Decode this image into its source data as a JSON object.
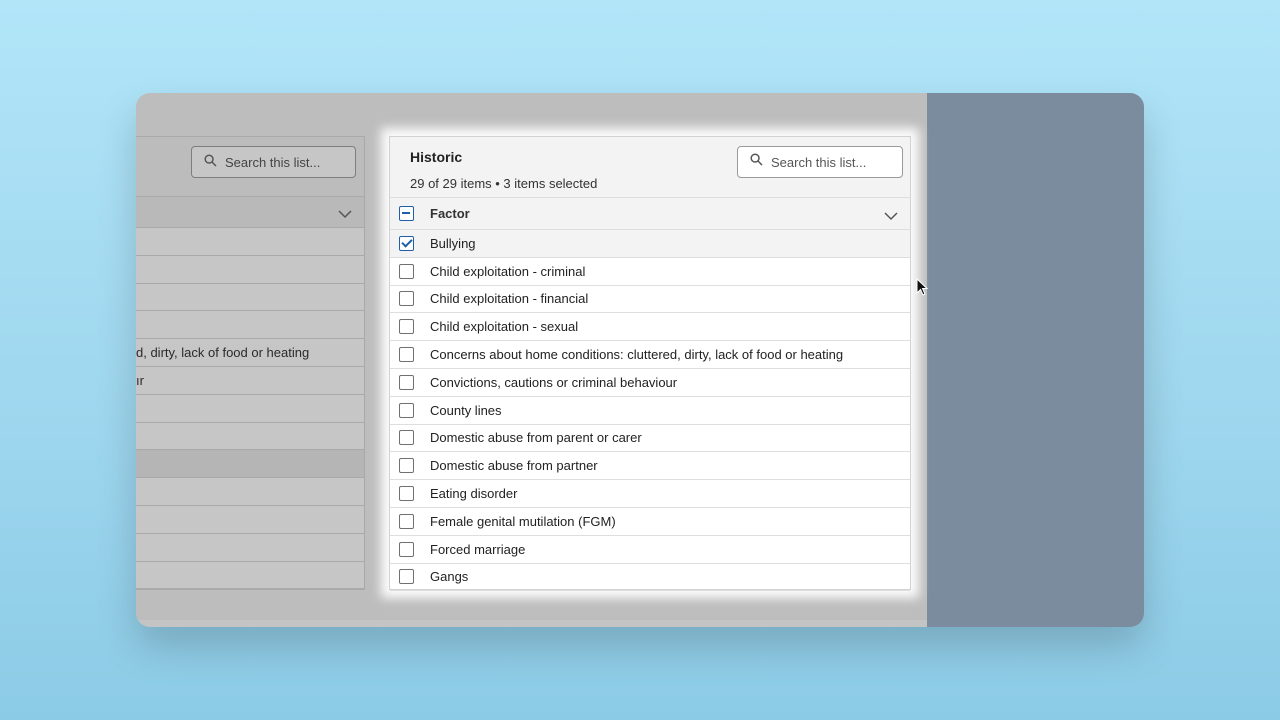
{
  "background_panel": {
    "search_placeholder": "Search this list...",
    "rows": [
      "",
      "",
      "",
      "",
      "d, dirty, lack of food or heating",
      "ır",
      "",
      "",
      "",
      "",
      "",
      "",
      ""
    ]
  },
  "panel": {
    "title": "Historic",
    "subtitle": "29 of 29 items • 3 items selected",
    "search_placeholder": "Search this list...",
    "column_header": "Factor",
    "items": [
      {
        "label": "Bullying",
        "checked": true
      },
      {
        "label": "Child exploitation - criminal",
        "checked": false
      },
      {
        "label": "Child exploitation - financial",
        "checked": false
      },
      {
        "label": "Child exploitation - sexual",
        "checked": false
      },
      {
        "label": "Concerns about home conditions: cluttered, dirty, lack of food or heating",
        "checked": false
      },
      {
        "label": "Convictions, cautions or criminal behaviour",
        "checked": false
      },
      {
        "label": "County lines",
        "checked": false
      },
      {
        "label": "Domestic abuse from parent or carer",
        "checked": false
      },
      {
        "label": "Domestic abuse from partner",
        "checked": false
      },
      {
        "label": "Eating disorder",
        "checked": false
      },
      {
        "label": "Female genital mutilation (FGM)",
        "checked": false
      },
      {
        "label": "Forced marriage",
        "checked": false
      },
      {
        "label": "Gangs",
        "checked": false
      }
    ]
  },
  "colors": {
    "accent": "#1f5fa8",
    "side_panel": "#7a8c9d",
    "page_background": "#a8dcf3"
  },
  "icons": {
    "search": "search-icon",
    "dropdown": "chevron-down-icon",
    "cursor": "mouse-pointer-icon"
  }
}
